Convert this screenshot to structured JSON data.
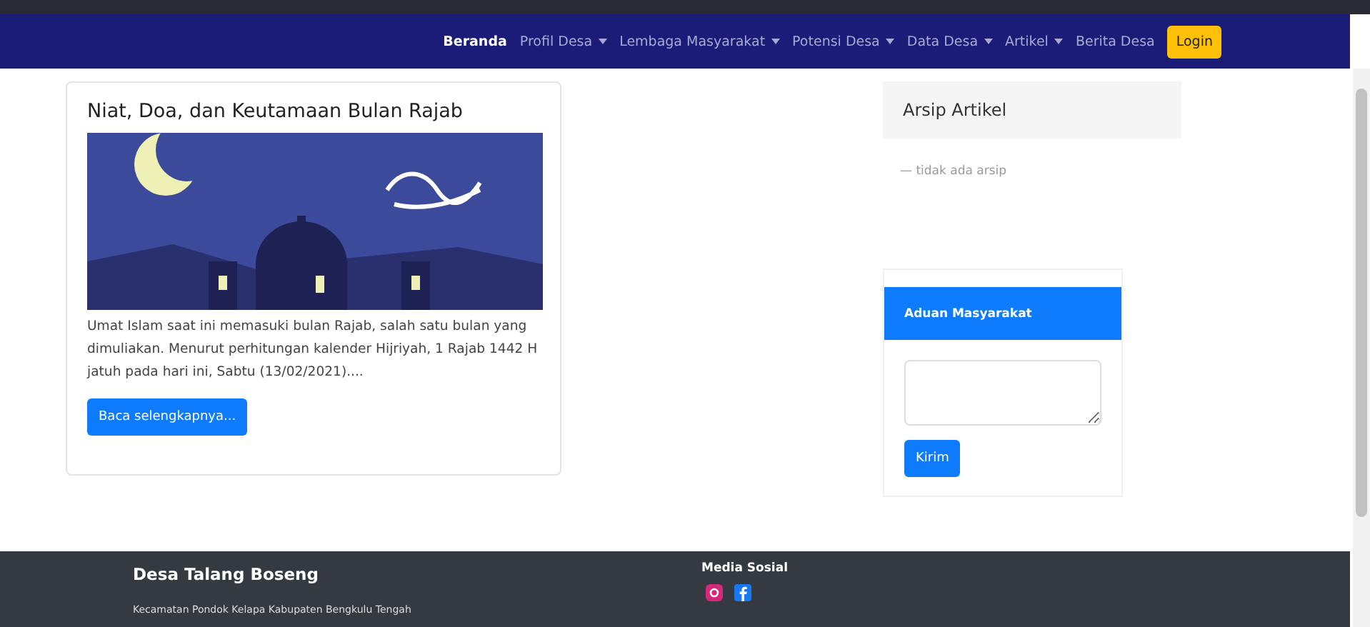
{
  "navbar": {
    "items": [
      {
        "label": "Beranda",
        "kind": "link",
        "selected": true
      },
      {
        "label": "Profil Desa",
        "kind": "dropdown",
        "selected": false
      },
      {
        "label": "Lembaga Masyarakat",
        "kind": "dropdown",
        "selected": false
      },
      {
        "label": "Potensi Desa",
        "kind": "dropdown",
        "selected": false
      },
      {
        "label": "Data Desa",
        "kind": "dropdown",
        "selected": false
      },
      {
        "label": "Artikel",
        "kind": "dropdown",
        "selected": false
      },
      {
        "label": "Berita Desa",
        "kind": "link",
        "selected": false
      },
      {
        "label": "Login",
        "kind": "button",
        "selected": false
      }
    ]
  },
  "article": {
    "title": "Niat, Doa, dan Keutamaan Bulan Rajab",
    "excerpt": "Umat Islam saat ini memasuki bulan Rajab, salah satu bulan yang dimuliakan. Menurut perhitungan kalender Hijriyah, 1 Rajab 1442 H jatuh pada hari ini, Sabtu (13/02/2021)....",
    "button": "Baca selengkapnya..."
  },
  "archive": {
    "title": "Arsip Artikel",
    "empty_text": "— tidak ada arsip"
  },
  "complaint": {
    "title": "Aduan Masyarakat",
    "button": "Kirim"
  },
  "footer": {
    "title": "Desa Talang Boseng",
    "address": "Kecamatan Pondok Kelapa Kabupaten Bengkulu Tengah",
    "social_title": "Media Sosial"
  }
}
